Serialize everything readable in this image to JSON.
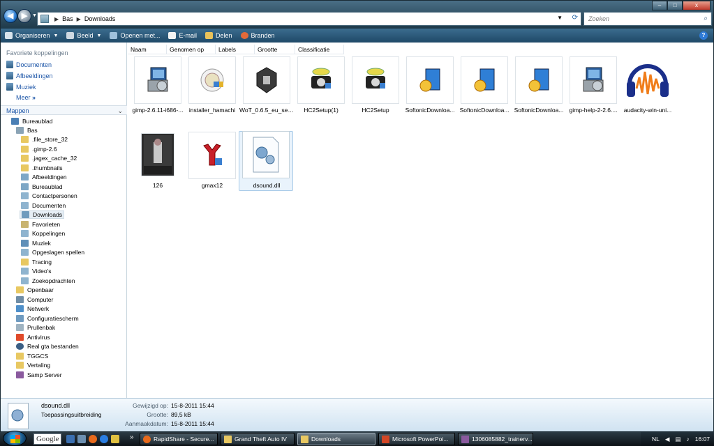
{
  "address": {
    "back_label": "◀",
    "forward_label": "▶",
    "path": [
      "Bas",
      "Downloads"
    ],
    "search_placeholder": "Zoeken"
  },
  "window_controls": {
    "minimize": "–",
    "maximize": "□",
    "close": "x"
  },
  "toolbar": {
    "items": [
      "Organiseren",
      "Beeld",
      "Openen met...",
      "E-mail",
      "Delen",
      "Branden"
    ],
    "help": "?"
  },
  "nav": {
    "favorites_title": "Favoriete koppelingen",
    "favorites": [
      "Documenten",
      "Afbeeldingen",
      "Muziek"
    ],
    "more": "Meer",
    "more_chevron": "»",
    "folders_title": "Mappen",
    "tree": [
      "Bureaublad",
      "Bas",
      ".file_store_32",
      ".gimp-2.6",
      ".jagex_cache_32",
      ".thumbnails",
      "Afbeeldingen",
      "Bureaublad",
      "Contactpersonen",
      "Documenten",
      "Downloads",
      "Favorieten",
      "Koppelingen",
      "Muziek",
      "Opgeslagen spellen",
      "Tracing",
      "Video's",
      "Zoekopdrachten",
      "Openbaar",
      "Computer",
      "Netwerk",
      "Configuratiescherm",
      "Prullenbak",
      "Antivirus",
      "Real gta bestanden",
      "TGGCS",
      "Vertaling",
      "Samp Server"
    ]
  },
  "columns": [
    "Naam",
    "Genomen op",
    "Labels",
    "Grootte",
    "Classificatie"
  ],
  "files": [
    {
      "name": "gimp-2.6.11-i686-...",
      "icon": "installer-icon"
    },
    {
      "name": "installer_hamachi",
      "icon": "hamachi-icon"
    },
    {
      "name": "WoT_0.6.5_eu_setup",
      "icon": "world-of-tanks-icon"
    },
    {
      "name": "HC2Setup(1)",
      "icon": "setup-camera-icon"
    },
    {
      "name": "HC2Setup",
      "icon": "setup-camera-icon"
    },
    {
      "name": "SoftonicDownloa...",
      "icon": "softonic-box-icon"
    },
    {
      "name": "SoftonicDownloa...",
      "icon": "softonic-box-icon"
    },
    {
      "name": "SoftonicDownloa...",
      "icon": "softonic-box-icon"
    },
    {
      "name": "gimp-help-2-2.6....",
      "icon": "installer-icon"
    },
    {
      "name": "audacity-win-uni...",
      "icon": "audacity-icon"
    },
    {
      "name": "126",
      "icon": "photo-thumbnail"
    },
    {
      "name": "gmax12",
      "icon": "gmax-icon"
    },
    {
      "name": "dsound.dll",
      "icon": "dll-gear-icon"
    }
  ],
  "details": {
    "name": "dsound.dll",
    "type": "Toepassingsuitbreiding",
    "modified_label": "Gewijzigd op:",
    "modified": "15-8-2011 15:44",
    "size_label": "Grootte:",
    "size": "89,5 kB",
    "created_label": "Aanmaakdatum:",
    "created": "15-8-2011 15:44"
  },
  "taskbar": {
    "google": "Google",
    "more": "»",
    "tasks": [
      "RapidShare - Secure...",
      "Grand Theft Auto IV",
      "Downloads",
      "Microsoft PowerPoi...",
      "1306085882_trainerv..."
    ],
    "tray": {
      "lang": "NL",
      "time": "16:07"
    }
  }
}
